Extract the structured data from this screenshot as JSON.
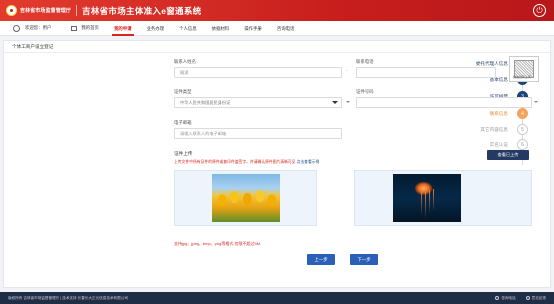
{
  "header": {
    "org_name": "吉林省市场监督管理厅",
    "system_title": "吉林省市场主体准入e窗通系统",
    "power_glyph": "⏻"
  },
  "nav": {
    "user_label": "欢迎您：用户",
    "home_label": "我的首页",
    "items": [
      {
        "label": "我的申请",
        "active": true
      },
      {
        "label": "业务办理",
        "active": false
      },
      {
        "label": "个人信息",
        "active": false
      },
      {
        "label": "依据材料",
        "active": false
      },
      {
        "label": "操作手册",
        "active": false
      },
      {
        "label": "咨询电话",
        "active": false
      }
    ]
  },
  "panel": {
    "title": "个体工商户设立登记"
  },
  "steps": [
    {
      "label": "委托代理人信息",
      "num": "1",
      "state": "done"
    },
    {
      "label": "基本信息",
      "num": "2",
      "state": "done"
    },
    {
      "label": "许可经营",
      "num": "3",
      "state": "done"
    },
    {
      "label": "联系信息",
      "num": "4",
      "state": "current"
    },
    {
      "label": "其它内容信息",
      "num": "5",
      "state": "pending"
    },
    {
      "label": "实名认证",
      "num": "6",
      "state": "pending"
    }
  ],
  "form": {
    "contact_name_label": "联系人姓名",
    "contact_name_value": "同洋",
    "contact_phone_label": "联系电话",
    "contact_phone_value": "",
    "id_type_label": "证件类型",
    "id_type_value": "中华人民共和国居民身份证",
    "id_number_label": "证件号码",
    "id_number_value": "",
    "email_label": "电子邮箱",
    "email_placeholder": "请输入联系人的电子邮箱",
    "qr_note": "微信扫码上传"
  },
  "upload": {
    "section_label": "证件上传",
    "notice_text": "上传文件中所有证件的原件或复印件盖签字，并请确认原件图片清晰可见 ",
    "notice_link": "点击查看示例",
    "batch_button": "查看已上传",
    "format_notice": "支持jpg、jpeg、bmp、png等格式 仅限不超过5M"
  },
  "buttons": {
    "prev": "上一步",
    "next": "下一步"
  },
  "footer": {
    "left_text": "版权所有 吉林省市场监督管理厅 | 技术支持 长春长大正元信息技术有限公司",
    "service_label": "咨询电话",
    "feedback_label": "意见反馈"
  }
}
